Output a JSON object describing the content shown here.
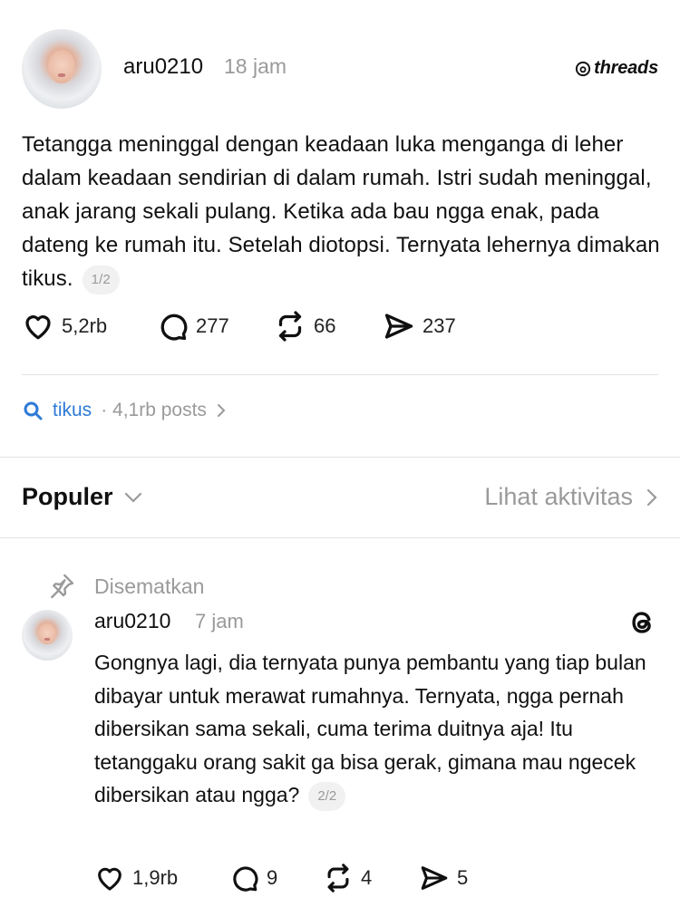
{
  "post": {
    "username": "aru0210",
    "time": "18 jam",
    "brand": "threads",
    "text": "Tetangga meninggal dengan keadaan luka menganga di leher dalam keadaan sendirian di dalam rumah. Istri sudah meninggal, anak jarang sekali pulang. Ketika ada bau ngga enak, pada dateng ke rumah itu. Setelah diotopsi. Ternyata lehernya dimakan tikus.",
    "page_indicator": "1/2",
    "likes": "5,2rb",
    "comments": "277",
    "reposts": "66",
    "shares": "237"
  },
  "topic": {
    "tag": "tikus",
    "count": "· 4,1rb posts"
  },
  "replies_header": {
    "sort_label": "Populer",
    "activity_label": "Lihat aktivitas"
  },
  "reply": {
    "pinned_label": "Disematkan",
    "username": "aru0210",
    "time": "7 jam",
    "text": "Gongnya lagi, dia ternyata punya pembantu yang tiap bulan dibayar untuk merawat rumahnya. Ternyata, ngga pernah dibersikan sama sekali, cuma terima duitnya aja! Itu tetanggaku orang sakit ga bisa gerak, gimana mau ngecek dibersikan atau ngga?",
    "page_indicator": "2/2",
    "likes": "1,9rb",
    "comments": "9",
    "reposts": "4",
    "shares": "5"
  },
  "colors": {
    "link": "#2d7ad6",
    "muted": "#9a9a9a",
    "divider": "#e3e3e3"
  },
  "icons": [
    "heart-icon",
    "comment-icon",
    "repost-icon",
    "share-icon",
    "search-icon",
    "chevron-right-icon",
    "chevron-down-icon",
    "pin-icon",
    "threads-logo-icon"
  ]
}
